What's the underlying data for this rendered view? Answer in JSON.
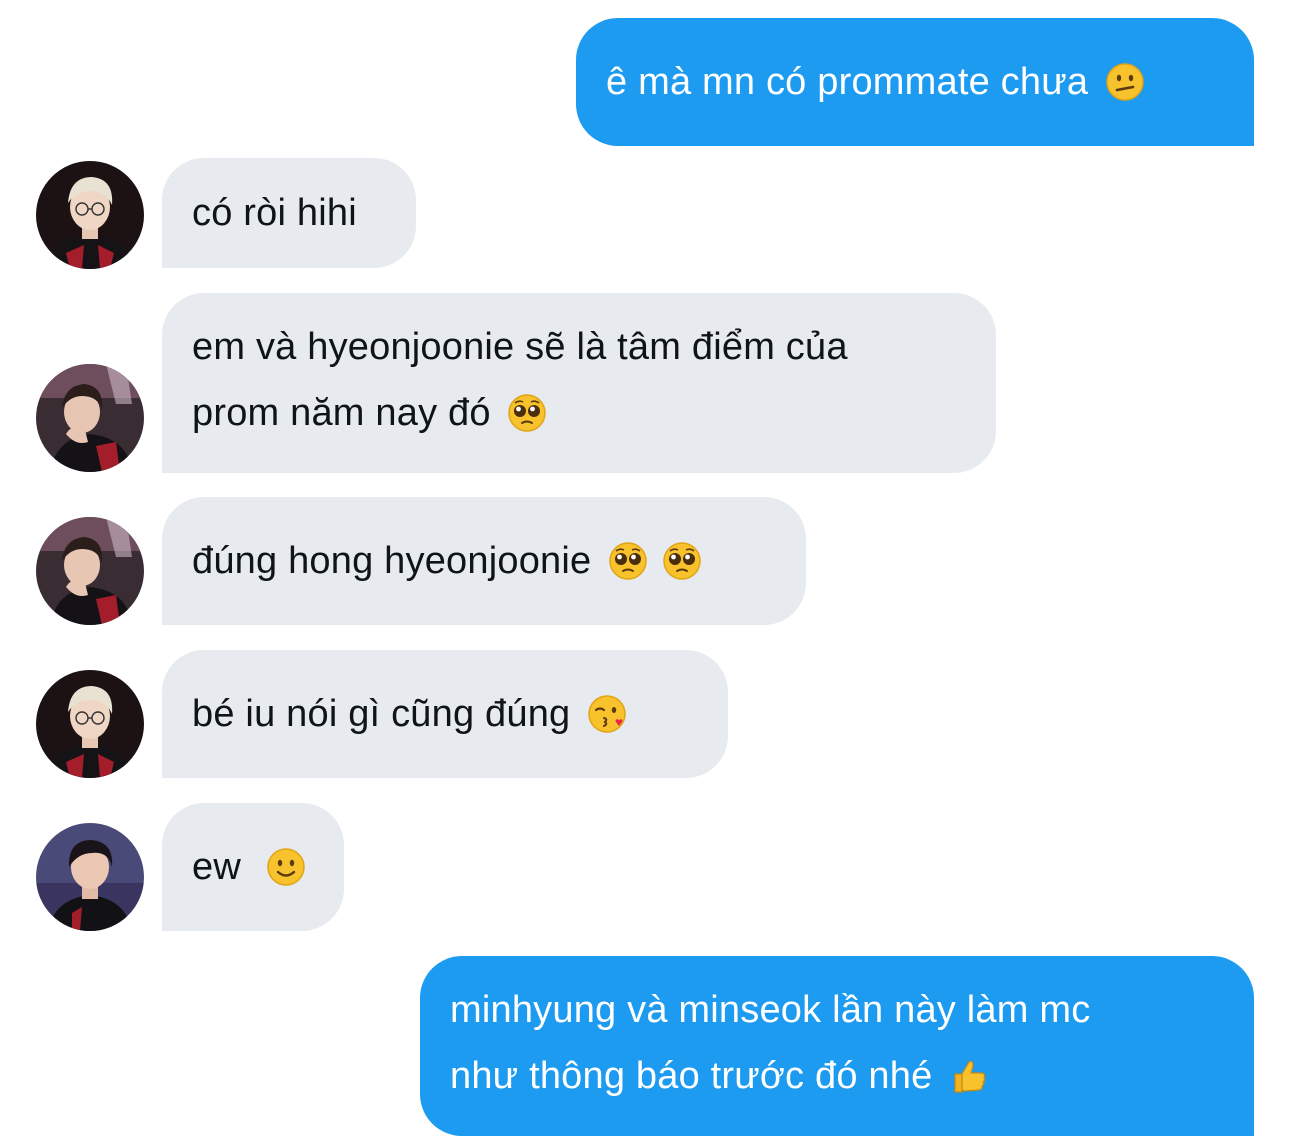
{
  "messages": [
    {
      "id": "m1",
      "direction": "outgoing",
      "lines": [
        "ê mà mn có prommate chưa"
      ],
      "emoji": [
        "confused-face"
      ]
    },
    {
      "id": "m2",
      "direction": "incoming",
      "avatar": "avatar-blonde-glasses",
      "lines": [
        "có ròi hihi"
      ],
      "emoji": []
    },
    {
      "id": "m3",
      "direction": "incoming",
      "avatar": "avatar-hand-on-chin",
      "lines": [
        "em và hyeonjoonie sẽ là tâm điểm của",
        "prom năm nay đó"
      ],
      "emoji": [
        "pleading-face"
      ]
    },
    {
      "id": "m4",
      "direction": "incoming",
      "avatar": "avatar-hand-on-chin",
      "lines": [
        "đúng hong hyeonjoonie"
      ],
      "emoji": [
        "pleading-face",
        "pleading-face"
      ]
    },
    {
      "id": "m5",
      "direction": "incoming",
      "avatar": "avatar-blonde-glasses",
      "lines": [
        "bé iu nói gì cũng đúng"
      ],
      "emoji": [
        "face-blowing-kiss"
      ]
    },
    {
      "id": "m6",
      "direction": "incoming",
      "avatar": "avatar-dark-hair",
      "lines": [
        "ew"
      ],
      "emoji": [
        "slightly-smiling-face"
      ]
    },
    {
      "id": "m7",
      "direction": "outgoing",
      "lines": [
        "minhyung và minseok lần này làm mc",
        "như thông báo trước đó nhé"
      ],
      "emoji": [
        "thumbs-up"
      ]
    }
  ],
  "colors": {
    "outgoing_bubble": "#1d9bf0",
    "incoming_bubble": "#e7ebef",
    "outgoing_text": "#ffffff",
    "incoming_text": "#0f1419",
    "background": "#ffffff"
  }
}
